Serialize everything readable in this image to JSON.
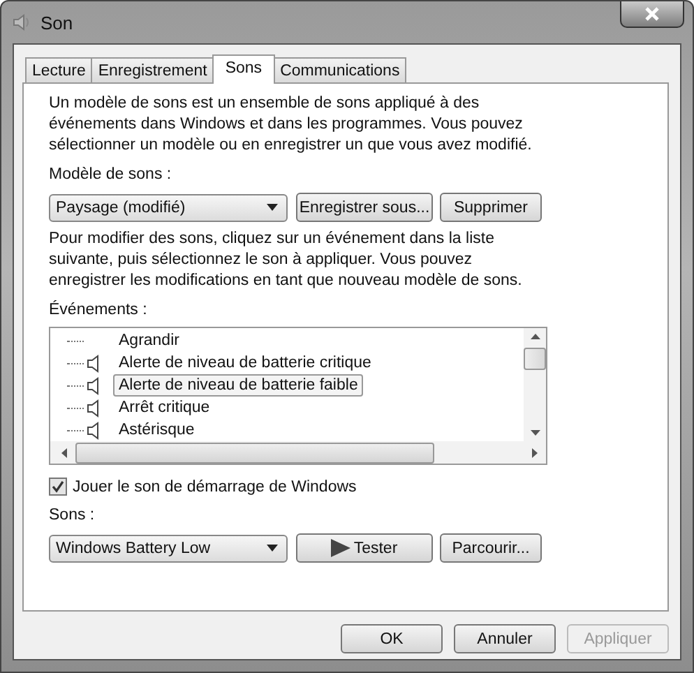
{
  "window": {
    "title": "Son"
  },
  "tabs": [
    {
      "label": "Lecture",
      "selected": false
    },
    {
      "label": "Enregistrement",
      "selected": false
    },
    {
      "label": "Sons",
      "selected": true
    },
    {
      "label": "Communications",
      "selected": false
    }
  ],
  "intro": "Un modèle de sons est un ensemble de sons appliqué à des événements dans Windows et dans les programmes. Vous pouvez sélectionner un modèle ou en enregistrer un que vous avez modifié.",
  "scheme": {
    "label": "Modèle de sons :",
    "value": "Paysage (modifié)",
    "buttons": [
      {
        "label": "Enregistrer sous..."
      },
      {
        "label": "Supprimer"
      }
    ]
  },
  "instructions": "Pour modifier des sons, cliquez sur un événement dans la liste suivante, puis sélectionnez le son à appliquer. Vous pouvez enregistrer les modifications en tant que nouveau modèle de sons.",
  "events": {
    "label": "Événements :",
    "items": [
      {
        "label": "Agrandir",
        "has_sound": false,
        "selected": false
      },
      {
        "label": "Alerte de niveau de batterie critique",
        "has_sound": true,
        "selected": false
      },
      {
        "label": "Alerte de niveau de batterie faible",
        "has_sound": true,
        "selected": true
      },
      {
        "label": "Arrêt critique",
        "has_sound": true,
        "selected": false
      },
      {
        "label": "Astérisque",
        "has_sound": true,
        "selected": false
      }
    ]
  },
  "startup_sound": {
    "label": "Jouer le son de démarrage de Windows",
    "checked": true
  },
  "sounds": {
    "label": "Sons :",
    "value": "Windows Battery Low",
    "buttons": [
      {
        "label": "Tester",
        "kind": "play"
      },
      {
        "label": "Parcourir...",
        "kind": "plain"
      }
    ]
  },
  "footer_buttons": [
    {
      "label": "OK",
      "disabled": false
    },
    {
      "label": "Annuler",
      "disabled": false
    },
    {
      "label": "Appliquer",
      "disabled": true
    }
  ]
}
